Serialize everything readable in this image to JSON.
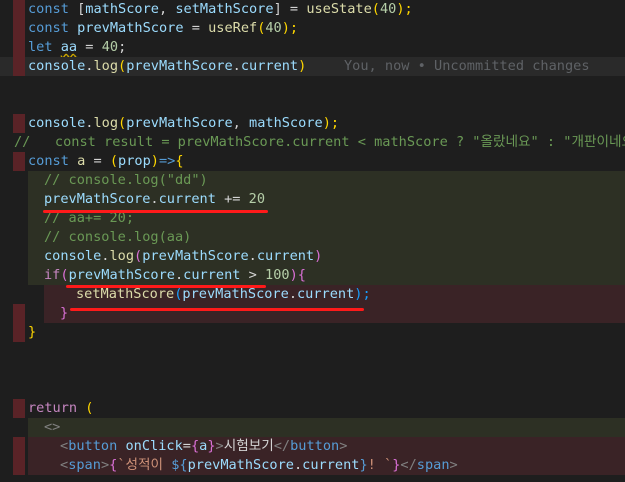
{
  "lines": [
    {
      "id": "l1",
      "t": [
        "const",
        " [",
        "mathScore",
        ", ",
        "setMathScore",
        "] = ",
        "useState",
        "(",
        "40",
        ");"
      ]
    },
    {
      "id": "l2",
      "t": [
        "const",
        " ",
        "prevMathScore",
        " = ",
        "useRef",
        "(",
        "40",
        ");"
      ]
    },
    {
      "id": "l3",
      "t": [
        "let",
        " ",
        "aa",
        " = ",
        "40",
        ";"
      ]
    },
    {
      "id": "l4",
      "t": [
        "console",
        ".",
        "log",
        "(",
        "prevMathScore",
        ".",
        "current",
        ")"
      ],
      "blame": "You, now • Uncommitted changes"
    },
    {
      "id": "l5",
      "t": [
        "console",
        ".",
        "log",
        "(",
        "prevMathScore",
        ", ",
        "mathScore",
        ");"
      ]
    },
    {
      "id": "l6",
      "t": [
        "//   const result = prevMathScore.current < mathScore ? \"올랐네요\" : \"개판이네요\";"
      ]
    },
    {
      "id": "l7",
      "t": [
        "const",
        " ",
        "a",
        " = ",
        "(",
        "prop",
        ")",
        "=>",
        "{"
      ]
    },
    {
      "id": "l8",
      "t": [
        "// console.log(\"dd\")"
      ]
    },
    {
      "id": "l9",
      "t": [
        "prevMathScore",
        ".",
        "current",
        " += ",
        "20"
      ]
    },
    {
      "id": "l10",
      "t": [
        "// aa+= 20;"
      ]
    },
    {
      "id": "l11",
      "t": [
        "// console.log(aa)"
      ]
    },
    {
      "id": "l12",
      "t": [
        "console",
        ".",
        "log",
        "(",
        "prevMathScore",
        ".",
        "current",
        ")"
      ]
    },
    {
      "id": "l13",
      "t": [
        "if",
        "(",
        "prevMathScore",
        ".",
        "current",
        " > ",
        "100",
        ")",
        "{"
      ]
    },
    {
      "id": "l14",
      "t": [
        "setMathScore",
        "(",
        "prevMathScore",
        ".",
        "current",
        ");"
      ]
    },
    {
      "id": "l15",
      "t": [
        "}"
      ]
    },
    {
      "id": "l16",
      "t": [
        "}"
      ]
    },
    {
      "id": "l17",
      "t": [
        "return",
        " ("
      ]
    },
    {
      "id": "l18",
      "t": [
        "<>"
      ]
    },
    {
      "id": "l19",
      "t": [
        "<",
        "button",
        " ",
        "onClick",
        "=",
        "{",
        "a",
        "}",
        ">",
        "시험보기",
        "</",
        "button",
        ">"
      ]
    },
    {
      "id": "l20",
      "t": [
        "<",
        "span",
        ">",
        "{",
        "`성적이 ",
        "${",
        "prevMathScore",
        ".",
        "current",
        "}",
        "! `",
        "}",
        "</",
        "span",
        ">"
      ]
    }
  ]
}
